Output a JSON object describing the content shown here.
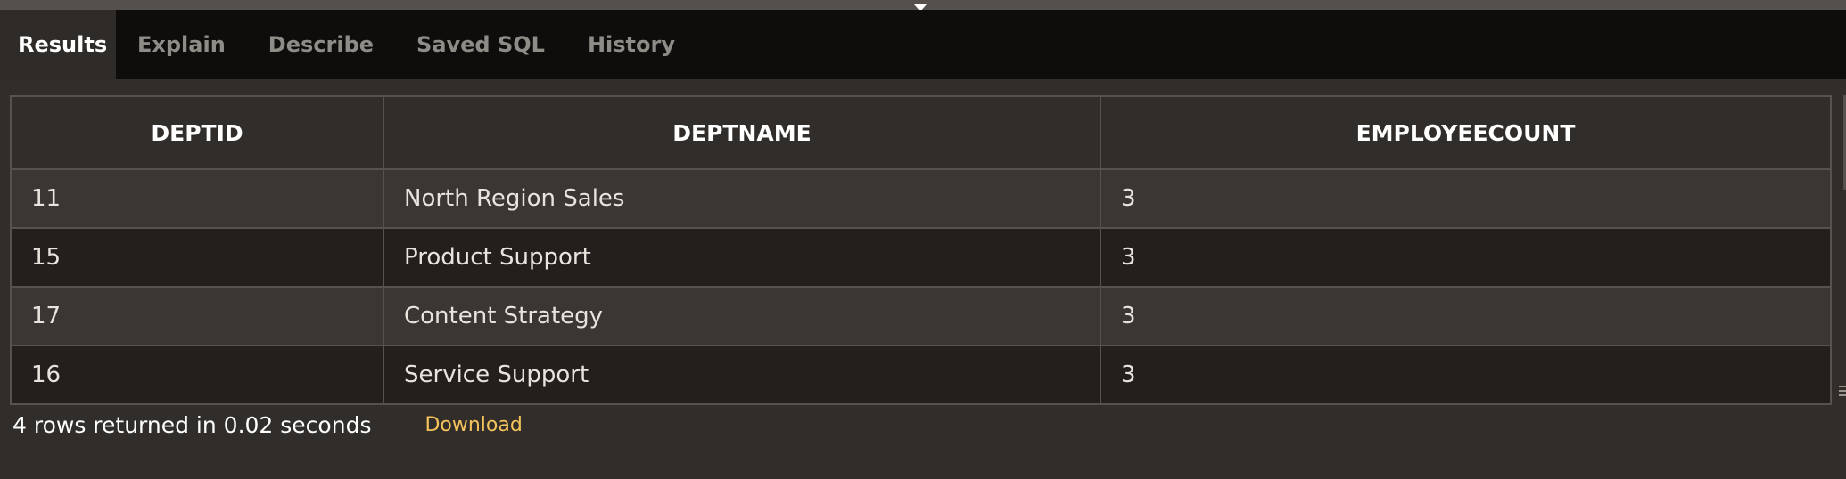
{
  "tabs": [
    {
      "label": "Results",
      "active": true
    },
    {
      "label": "Explain",
      "active": false
    },
    {
      "label": "Describe",
      "active": false
    },
    {
      "label": "Saved SQL",
      "active": false
    },
    {
      "label": "History",
      "active": false
    }
  ],
  "table": {
    "columns": [
      "DEPTID",
      "DEPTNAME",
      "EMPLOYEECOUNT"
    ],
    "rows": [
      [
        "11",
        "North Region Sales",
        "3"
      ],
      [
        "15",
        "Product Support",
        "3"
      ],
      [
        "17",
        "Content Strategy",
        "3"
      ],
      [
        "16",
        "Service Support",
        "3"
      ]
    ]
  },
  "status": {
    "text": "4 rows returned in 0.02 seconds",
    "download_label": "Download"
  },
  "colors": {
    "background": "#312d2a",
    "tab_bar": "#0e0d0b",
    "link": "#f4c35b"
  },
  "icons": {
    "splitter": "splitter-handle-icon",
    "grip": "resize-grip-icon"
  }
}
